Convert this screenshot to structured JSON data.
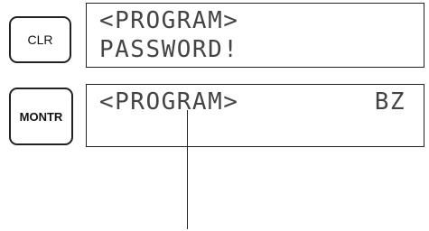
{
  "keys": {
    "clr": "CLR",
    "montr": "MONTR"
  },
  "display1": {
    "line1": "<PROGRAM>",
    "line2": "PASSWORD!"
  },
  "display2": {
    "line1": "<PROGRAM>",
    "status": "BZ"
  }
}
